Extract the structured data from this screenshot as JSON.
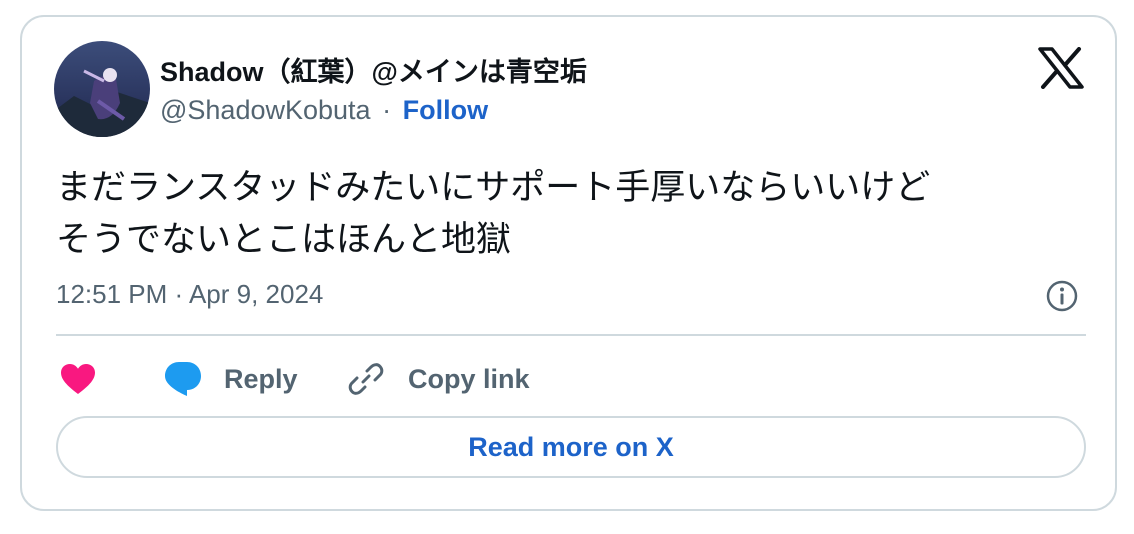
{
  "author": {
    "display_name": "Shadow（紅葉）@メインは青空垢",
    "handle": "@ShadowKobuta",
    "separator": "·",
    "follow_label": "Follow"
  },
  "tweet": {
    "text_line1": "まだランスタッドみたいにサポート手厚いならいいけど",
    "text_line2": "そうでないとこはほんと地獄",
    "timestamp": "12:51 PM · Apr 9, 2024"
  },
  "actions": {
    "reply_label": "Reply",
    "copy_link_label": "Copy link"
  },
  "read_more_label": "Read more on X",
  "icons": {
    "logo": "x-logo-icon",
    "info": "info-icon",
    "like": "heart-icon",
    "reply": "speech-bubble-icon",
    "copy": "link-icon"
  },
  "colors": {
    "link_blue": "#1d63c9",
    "heart_pink": "#f91880",
    "reply_blue": "#1d9bf0",
    "secondary_text": "#536471",
    "border": "#cfd9de"
  }
}
